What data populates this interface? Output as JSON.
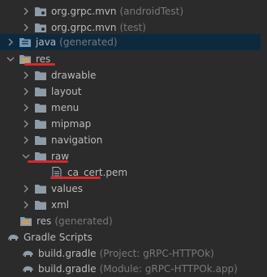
{
  "tree": [
    {
      "id": "org-grpc-mvn-androidtest",
      "label": "org.grpc.mvn",
      "meta": "(androidTest)",
      "arrow": "right",
      "icon": "package-folder"
    },
    {
      "id": "org-grpc-mvn-test",
      "label": "org.grpc.mvn",
      "meta": "(test)",
      "arrow": "right",
      "icon": "package-folder"
    },
    {
      "id": "java-generated",
      "label": "java",
      "meta": "(generated)",
      "arrow": "right",
      "icon": "generated-folder",
      "selected": true
    },
    {
      "id": "res",
      "label": "res",
      "meta": "",
      "arrow": "down",
      "icon": "resource-folder"
    },
    {
      "id": "drawable",
      "label": "drawable",
      "meta": "",
      "arrow": "right",
      "icon": "folder"
    },
    {
      "id": "layout",
      "label": "layout",
      "meta": "",
      "arrow": "right",
      "icon": "folder"
    },
    {
      "id": "menu",
      "label": "menu",
      "meta": "",
      "arrow": "right",
      "icon": "folder"
    },
    {
      "id": "mipmap",
      "label": "mipmap",
      "meta": "",
      "arrow": "right",
      "icon": "folder"
    },
    {
      "id": "navigation",
      "label": "navigation",
      "meta": "",
      "arrow": "right",
      "icon": "folder"
    },
    {
      "id": "raw",
      "label": "raw",
      "meta": "",
      "arrow": "down",
      "icon": "folder"
    },
    {
      "id": "ca-cert",
      "label": "ca_cert.pem",
      "meta": "",
      "arrow": "none",
      "icon": "file"
    },
    {
      "id": "values",
      "label": "values",
      "meta": "",
      "arrow": "right",
      "icon": "folder"
    },
    {
      "id": "xml",
      "label": "xml",
      "meta": "",
      "arrow": "right",
      "icon": "folder"
    },
    {
      "id": "res-generated",
      "label": "res",
      "meta": "(generated)",
      "arrow": "none",
      "icon": "resource-folder"
    },
    {
      "id": "gradle-scripts",
      "label": "Gradle Scripts",
      "meta": "",
      "arrow": "down",
      "icon": "gradle-elephant"
    },
    {
      "id": "build-gradle-project",
      "label": "build.gradle",
      "meta": "(Project: gRPC-HTTPOk)",
      "arrow": "none",
      "icon": "gradle-elephant"
    },
    {
      "id": "build-gradle-module",
      "label": "build.gradle",
      "meta": "(Module: gRPC-HTTPOk.app)",
      "arrow": "none",
      "icon": "gradle-elephant"
    }
  ],
  "colors": {
    "background": "#2b2b2b",
    "selection": "#0d293e",
    "text": "#bbbbbb",
    "meta_text": "#787878",
    "folder": "#8f9ba6",
    "annotation": "#d9282a"
  }
}
